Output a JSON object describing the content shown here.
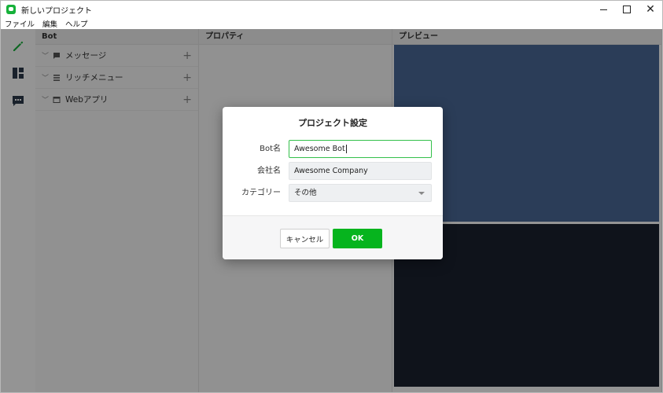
{
  "window": {
    "title": "新しいプロジェクト",
    "controls": {
      "minimize": "",
      "maximize": "",
      "close": "✕"
    }
  },
  "menu": [
    "ファイル",
    "編集",
    "ヘルプ"
  ],
  "rail": {
    "items": [
      {
        "icon": "pencil-icon",
        "active": true
      },
      {
        "icon": "layout-icon",
        "active": false
      },
      {
        "icon": "chat-icon",
        "active": false
      }
    ]
  },
  "panes": {
    "bot": {
      "header": "Bot",
      "items": [
        {
          "label": "メッセージ",
          "icon": "speech-bubble-icon"
        },
        {
          "label": "リッチメニュー",
          "icon": "list-icon"
        },
        {
          "label": "Webアプリ",
          "icon": "browser-window-icon"
        }
      ]
    },
    "properties": {
      "header": "プロパティ"
    },
    "preview": {
      "header": "プレビュー"
    }
  },
  "dialog": {
    "title": "プロジェクト設定",
    "fields": [
      {
        "label": "Bot名",
        "value": "Awesome Bot",
        "focused": true
      },
      {
        "label": "会社名",
        "value": "Awesome Company",
        "focused": false
      },
      {
        "label": "カテゴリー",
        "value": "その他",
        "type": "select"
      }
    ],
    "buttons": {
      "cancel": "キャンセル",
      "ok": "OK"
    }
  },
  "colors": {
    "accent": "#06b41e",
    "focus_border": "#33c04a",
    "preview_top": "#4a6a98",
    "preview_bottom": "#1b2230"
  }
}
